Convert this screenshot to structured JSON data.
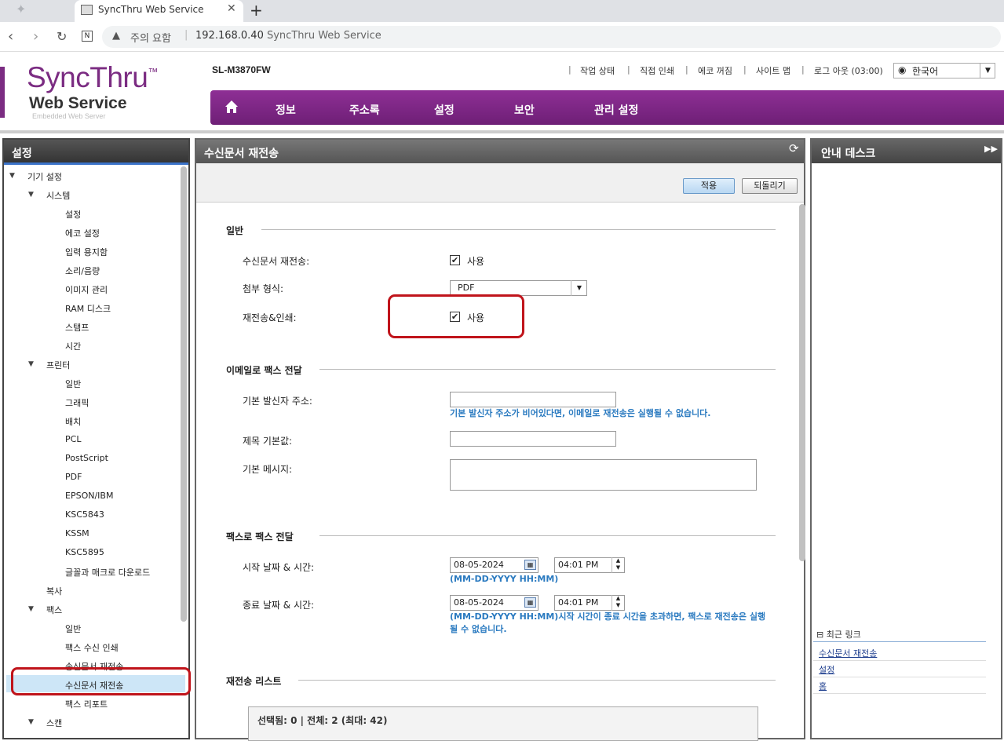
{
  "browser": {
    "tab_title": "SyncThru Web Service",
    "new_tab": "+",
    "close": "✕",
    "warning": "주의 요함",
    "separator": "|",
    "url": "192.168.0.40",
    "url_title": "SyncThru Web Service"
  },
  "header": {
    "logo_sync": "SyncThru",
    "logo_tm": "™",
    "logo_web": "Web Service",
    "logo_sub": "Embedded Web Server",
    "model": "SL-M3870FW",
    "links": [
      "작업 상태",
      "직접 인쇄",
      "에코 꺼짐",
      "사이트 맵",
      "로그 아웃 (03:00)"
    ],
    "language": "한국어"
  },
  "menu": [
    "정보",
    "주소록",
    "설정",
    "보안",
    "관리 설정"
  ],
  "left": {
    "title": "설정",
    "tree": [
      {
        "label": "기기 설정",
        "lvl": 0,
        "open": true
      },
      {
        "label": "시스템",
        "lvl": 1,
        "open": true
      },
      {
        "label": "설정",
        "lvl": 2
      },
      {
        "label": "에코 설정",
        "lvl": 2
      },
      {
        "label": "입력 용지함",
        "lvl": 2
      },
      {
        "label": "소리/음량",
        "lvl": 2
      },
      {
        "label": "이미지 관리",
        "lvl": 2
      },
      {
        "label": "RAM 디스크",
        "lvl": 2
      },
      {
        "label": "스탬프",
        "lvl": 2
      },
      {
        "label": "시간",
        "lvl": 2
      },
      {
        "label": "프린터",
        "lvl": 1,
        "open": true
      },
      {
        "label": "일반",
        "lvl": 2
      },
      {
        "label": "그래픽",
        "lvl": 2
      },
      {
        "label": "배치",
        "lvl": 2
      },
      {
        "label": "PCL",
        "lvl": 2
      },
      {
        "label": "PostScript",
        "lvl": 2
      },
      {
        "label": "PDF",
        "lvl": 2
      },
      {
        "label": "EPSON/IBM",
        "lvl": 2
      },
      {
        "label": "KSC5843",
        "lvl": 2
      },
      {
        "label": "KSSM",
        "lvl": 2
      },
      {
        "label": "KSC5895",
        "lvl": 2
      },
      {
        "label": "글꼴과 매크로 다운로드",
        "lvl": 2
      },
      {
        "label": "복사",
        "lvl": 1
      },
      {
        "label": "팩스",
        "lvl": 1,
        "open": true
      },
      {
        "label": "일반",
        "lvl": 2
      },
      {
        "label": "팩스 수신 인쇄",
        "lvl": 2
      },
      {
        "label": "송신문서 재전송",
        "lvl": 2
      },
      {
        "label": "수신문서 재전송",
        "lvl": 2,
        "selected": true
      },
      {
        "label": "팩스 리포트",
        "lvl": 2
      },
      {
        "label": "스캔",
        "lvl": 1,
        "open": true
      }
    ]
  },
  "main": {
    "title": "수신문서 재전송",
    "apply": "적용",
    "revert": "되돌리기",
    "sec_general": "일반",
    "forward_label": "수신문서 재전송:",
    "forward_use": "사용",
    "attach_label": "첨부 형식:",
    "attach_value": "PDF",
    "print_label": "재전송&인쇄:",
    "print_use": "사용",
    "sec_email": "이메일로 팩스 전달",
    "sender_label": "기본 발신자 주소:",
    "sender_hint": "기본 발신자 주소가 비어있다면, 이메일로 재전송은 실행될 수 없습니다.",
    "subject_label": "제목 기본값:",
    "message_label": "기본 메시지:",
    "sec_fax": "팩스로 팩스 전달",
    "start_label": "시작 날짜 & 시간:",
    "start_date": "08-05-2024",
    "start_time": "04:01 PM",
    "start_hint": "(MM-DD-YYYY HH:MM)",
    "end_label": "종료 날짜 & 시간:",
    "end_date": "08-05-2024",
    "end_time": "04:01 PM",
    "end_hint": "(MM-DD-YYYY HH:MM)시작 시간이 종료 시간을 초과하면, 팩스로 재전송은 실행될 수 없습니다.",
    "sec_list": "재전송 리스트",
    "list_count": "선택됨: 0  |  전체: 2 (최대: 42)"
  },
  "right": {
    "title": "안내 데스크",
    "recent": "최근 링크",
    "links": [
      "수신문서 재전송",
      "설정",
      "홈"
    ]
  }
}
